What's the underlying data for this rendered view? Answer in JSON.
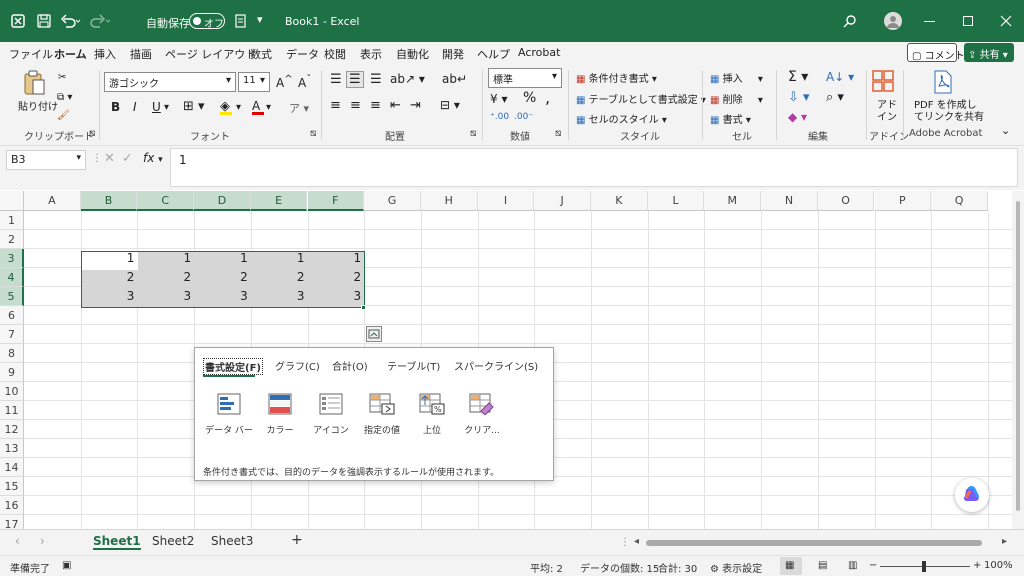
{
  "title": {
    "autosave": "自動保存",
    "toggle": "オフ",
    "doc": "Book1  -  Excel"
  },
  "tabs": [
    "ファイル",
    "ホーム",
    "挿入",
    "描画",
    "ページ レイアウト",
    "数式",
    "データ",
    "校閲",
    "表示",
    "自動化",
    "開発",
    "ヘルプ",
    "Acrobat"
  ],
  "tabs_active": "ホーム",
  "comment_btn": "コメント",
  "share_btn": "共有",
  "ribbon": {
    "paste": "貼り付け",
    "font_name": "游ゴシック",
    "font_size": "11",
    "number_format": "標準",
    "cond_format": "条件付き書式",
    "table_format": "テーブルとして書式設定",
    "cell_style": "セルのスタイル",
    "insert": "挿入",
    "delete": "削除",
    "format": "書式",
    "addin": "アド\nイン",
    "addin1": "アド",
    "addin2": "イン",
    "pdf1": "PDF を作成し",
    "pdf2": "てリンクを共有",
    "groups": [
      "クリップボード",
      "フォント",
      "配置",
      "数値",
      "スタイル",
      "セル",
      "編集",
      "アドイン",
      "Adobe Acrobat"
    ],
    "bold": "B",
    "italic": "I",
    "underline": "U",
    "font_grow": "A",
    "font_shrink": "A",
    "percent": "%",
    "comma": ","
  },
  "formula": {
    "namebox": "B3",
    "fx": "fx",
    "value": "1"
  },
  "columns": [
    "A",
    "B",
    "C",
    "D",
    "E",
    "F",
    "G",
    "H",
    "I",
    "J",
    "K",
    "L",
    "M",
    "N",
    "O",
    "P",
    "Q"
  ],
  "rows": [
    "1",
    "2",
    "3",
    "4",
    "5",
    "6",
    "7",
    "8",
    "9",
    "10",
    "11",
    "12",
    "13",
    "14",
    "15",
    "16",
    "17"
  ],
  "cells": {
    "r3": [
      "1",
      "1",
      "1",
      "1",
      "1"
    ],
    "r4": [
      "2",
      "2",
      "2",
      "2",
      "2"
    ],
    "r5": [
      "3",
      "3",
      "3",
      "3",
      "3"
    ]
  },
  "quick": {
    "tabs": [
      "書式設定(F)",
      "グラフ(C)",
      "合計(O)",
      "テーブル(T)",
      "スパークライン(S)"
    ],
    "items": [
      "データ バー",
      "カラー",
      "アイコン",
      "指定の値",
      "上位",
      "クリア..."
    ],
    "desc": "条件付き書式では、目的のデータを強調表示するルールが使用されます。"
  },
  "sheets": [
    "Sheet1",
    "Sheet2",
    "Sheet3"
  ],
  "add_sheet": "+",
  "status": {
    "ready": "準備完了",
    "avg": "平均: 2",
    "count": "データの個数: 15",
    "sum": "合計: 30",
    "display": "表示設定",
    "zoom": "100%"
  },
  "colors": {
    "brand": "#1e7145",
    "selection": "#c6dccf"
  }
}
